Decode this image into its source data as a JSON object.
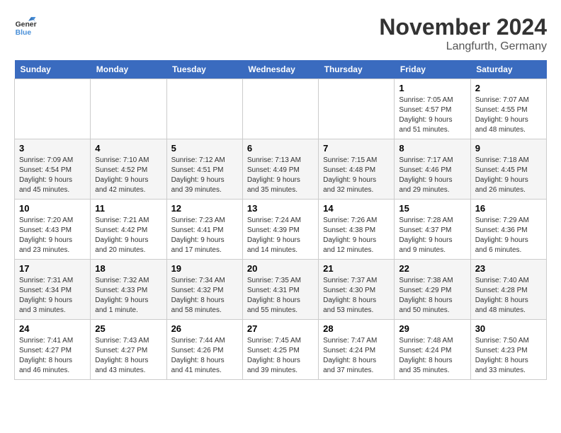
{
  "logo": {
    "text_general": "General",
    "text_blue": "Blue"
  },
  "header": {
    "month": "November 2024",
    "location": "Langfurth, Germany"
  },
  "weekdays": [
    "Sunday",
    "Monday",
    "Tuesday",
    "Wednesday",
    "Thursday",
    "Friday",
    "Saturday"
  ],
  "weeks": [
    [
      {
        "day": "",
        "sunrise": "",
        "sunset": "",
        "daylight": ""
      },
      {
        "day": "",
        "sunrise": "",
        "sunset": "",
        "daylight": ""
      },
      {
        "day": "",
        "sunrise": "",
        "sunset": "",
        "daylight": ""
      },
      {
        "day": "",
        "sunrise": "",
        "sunset": "",
        "daylight": ""
      },
      {
        "day": "",
        "sunrise": "",
        "sunset": "",
        "daylight": ""
      },
      {
        "day": "1",
        "sunrise": "Sunrise: 7:05 AM",
        "sunset": "Sunset: 4:57 PM",
        "daylight": "Daylight: 9 hours and 51 minutes."
      },
      {
        "day": "2",
        "sunrise": "Sunrise: 7:07 AM",
        "sunset": "Sunset: 4:55 PM",
        "daylight": "Daylight: 9 hours and 48 minutes."
      }
    ],
    [
      {
        "day": "3",
        "sunrise": "Sunrise: 7:09 AM",
        "sunset": "Sunset: 4:54 PM",
        "daylight": "Daylight: 9 hours and 45 minutes."
      },
      {
        "day": "4",
        "sunrise": "Sunrise: 7:10 AM",
        "sunset": "Sunset: 4:52 PM",
        "daylight": "Daylight: 9 hours and 42 minutes."
      },
      {
        "day": "5",
        "sunrise": "Sunrise: 7:12 AM",
        "sunset": "Sunset: 4:51 PM",
        "daylight": "Daylight: 9 hours and 39 minutes."
      },
      {
        "day": "6",
        "sunrise": "Sunrise: 7:13 AM",
        "sunset": "Sunset: 4:49 PM",
        "daylight": "Daylight: 9 hours and 35 minutes."
      },
      {
        "day": "7",
        "sunrise": "Sunrise: 7:15 AM",
        "sunset": "Sunset: 4:48 PM",
        "daylight": "Daylight: 9 hours and 32 minutes."
      },
      {
        "day": "8",
        "sunrise": "Sunrise: 7:17 AM",
        "sunset": "Sunset: 4:46 PM",
        "daylight": "Daylight: 9 hours and 29 minutes."
      },
      {
        "day": "9",
        "sunrise": "Sunrise: 7:18 AM",
        "sunset": "Sunset: 4:45 PM",
        "daylight": "Daylight: 9 hours and 26 minutes."
      }
    ],
    [
      {
        "day": "10",
        "sunrise": "Sunrise: 7:20 AM",
        "sunset": "Sunset: 4:43 PM",
        "daylight": "Daylight: 9 hours and 23 minutes."
      },
      {
        "day": "11",
        "sunrise": "Sunrise: 7:21 AM",
        "sunset": "Sunset: 4:42 PM",
        "daylight": "Daylight: 9 hours and 20 minutes."
      },
      {
        "day": "12",
        "sunrise": "Sunrise: 7:23 AM",
        "sunset": "Sunset: 4:41 PM",
        "daylight": "Daylight: 9 hours and 17 minutes."
      },
      {
        "day": "13",
        "sunrise": "Sunrise: 7:24 AM",
        "sunset": "Sunset: 4:39 PM",
        "daylight": "Daylight: 9 hours and 14 minutes."
      },
      {
        "day": "14",
        "sunrise": "Sunrise: 7:26 AM",
        "sunset": "Sunset: 4:38 PM",
        "daylight": "Daylight: 9 hours and 12 minutes."
      },
      {
        "day": "15",
        "sunrise": "Sunrise: 7:28 AM",
        "sunset": "Sunset: 4:37 PM",
        "daylight": "Daylight: 9 hours and 9 minutes."
      },
      {
        "day": "16",
        "sunrise": "Sunrise: 7:29 AM",
        "sunset": "Sunset: 4:36 PM",
        "daylight": "Daylight: 9 hours and 6 minutes."
      }
    ],
    [
      {
        "day": "17",
        "sunrise": "Sunrise: 7:31 AM",
        "sunset": "Sunset: 4:34 PM",
        "daylight": "Daylight: 9 hours and 3 minutes."
      },
      {
        "day": "18",
        "sunrise": "Sunrise: 7:32 AM",
        "sunset": "Sunset: 4:33 PM",
        "daylight": "Daylight: 9 hours and 1 minute."
      },
      {
        "day": "19",
        "sunrise": "Sunrise: 7:34 AM",
        "sunset": "Sunset: 4:32 PM",
        "daylight": "Daylight: 8 hours and 58 minutes."
      },
      {
        "day": "20",
        "sunrise": "Sunrise: 7:35 AM",
        "sunset": "Sunset: 4:31 PM",
        "daylight": "Daylight: 8 hours and 55 minutes."
      },
      {
        "day": "21",
        "sunrise": "Sunrise: 7:37 AM",
        "sunset": "Sunset: 4:30 PM",
        "daylight": "Daylight: 8 hours and 53 minutes."
      },
      {
        "day": "22",
        "sunrise": "Sunrise: 7:38 AM",
        "sunset": "Sunset: 4:29 PM",
        "daylight": "Daylight: 8 hours and 50 minutes."
      },
      {
        "day": "23",
        "sunrise": "Sunrise: 7:40 AM",
        "sunset": "Sunset: 4:28 PM",
        "daylight": "Daylight: 8 hours and 48 minutes."
      }
    ],
    [
      {
        "day": "24",
        "sunrise": "Sunrise: 7:41 AM",
        "sunset": "Sunset: 4:27 PM",
        "daylight": "Daylight: 8 hours and 46 minutes."
      },
      {
        "day": "25",
        "sunrise": "Sunrise: 7:43 AM",
        "sunset": "Sunset: 4:27 PM",
        "daylight": "Daylight: 8 hours and 43 minutes."
      },
      {
        "day": "26",
        "sunrise": "Sunrise: 7:44 AM",
        "sunset": "Sunset: 4:26 PM",
        "daylight": "Daylight: 8 hours and 41 minutes."
      },
      {
        "day": "27",
        "sunrise": "Sunrise: 7:45 AM",
        "sunset": "Sunset: 4:25 PM",
        "daylight": "Daylight: 8 hours and 39 minutes."
      },
      {
        "day": "28",
        "sunrise": "Sunrise: 7:47 AM",
        "sunset": "Sunset: 4:24 PM",
        "daylight": "Daylight: 8 hours and 37 minutes."
      },
      {
        "day": "29",
        "sunrise": "Sunrise: 7:48 AM",
        "sunset": "Sunset: 4:24 PM",
        "daylight": "Daylight: 8 hours and 35 minutes."
      },
      {
        "day": "30",
        "sunrise": "Sunrise: 7:50 AM",
        "sunset": "Sunset: 4:23 PM",
        "daylight": "Daylight: 8 hours and 33 minutes."
      }
    ]
  ]
}
